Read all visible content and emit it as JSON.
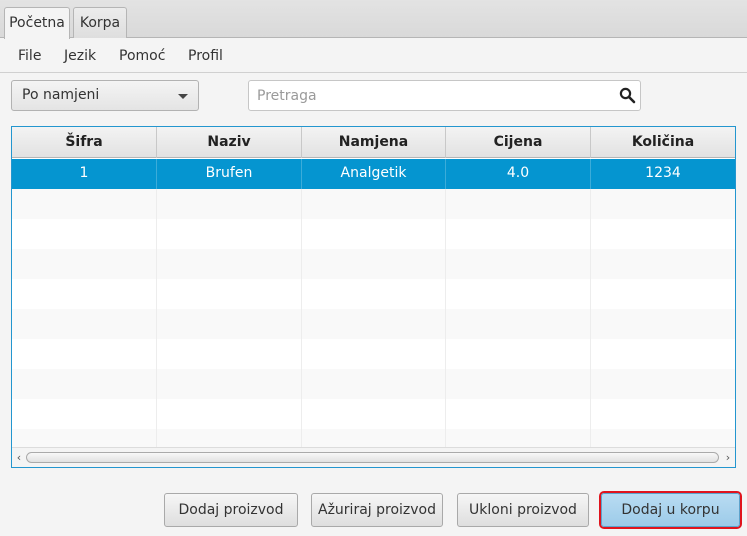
{
  "tabs": [
    {
      "label": "Početna",
      "active": true
    },
    {
      "label": "Korpa",
      "active": false
    }
  ],
  "menu": [
    "File",
    "Jezik",
    "Pomoć",
    "Profil"
  ],
  "filter": {
    "selected": "Po namjeni"
  },
  "search": {
    "placeholder": "Pretraga",
    "value": ""
  },
  "table": {
    "columns": [
      "Šifra",
      "Naziv",
      "Namjena",
      "Cijena",
      "Količina"
    ],
    "rows": [
      {
        "sifra": "1",
        "naziv": "Brufen",
        "namjena": "Analgetik",
        "cijena": "4.0",
        "kolicina": "1234",
        "selected": true
      }
    ]
  },
  "buttons": {
    "add_product": "Dodaj proizvod",
    "update_product": "Ažuriraj proizvod",
    "remove_product": "Ukloni proizvod",
    "add_to_cart": "Dodaj u korpu"
  },
  "colors": {
    "selection": "#0595d0",
    "highlight_border": "#e0141d",
    "focus_border": "#2396cf"
  }
}
